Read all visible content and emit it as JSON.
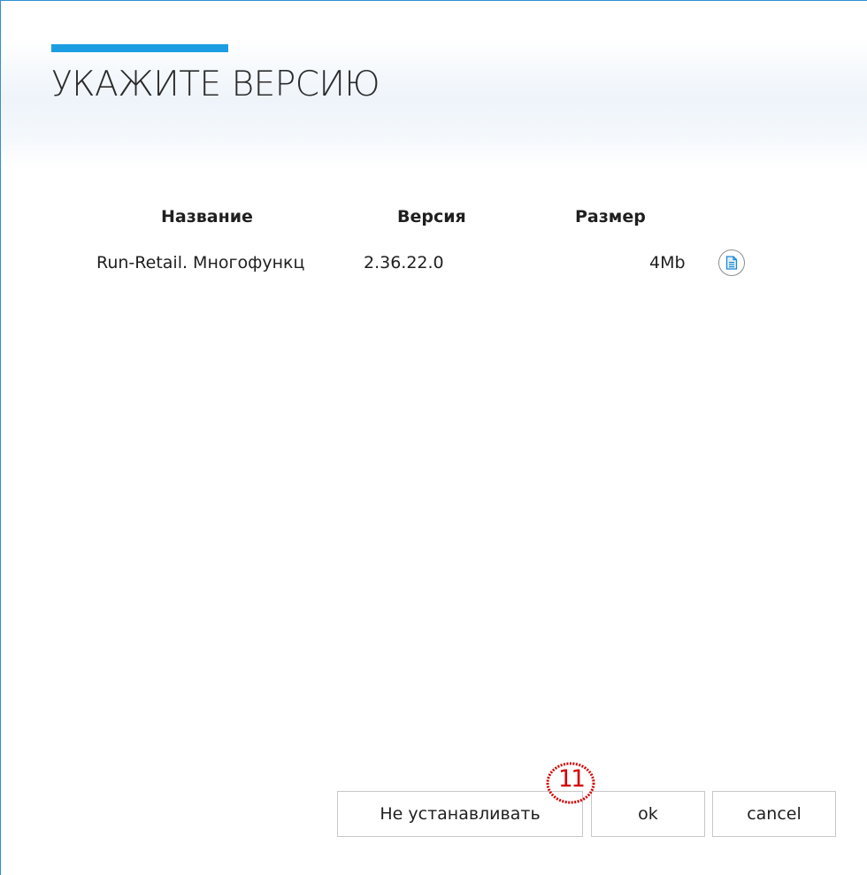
{
  "dialog": {
    "title": "УКАЖИТЕ ВЕРСИЮ",
    "accent_color": "#1c9de2",
    "border_color": "#2d8fd4"
  },
  "table": {
    "columns": [
      "Название",
      "Версия",
      "Размер"
    ],
    "rows": [
      {
        "name": "Run-Retail. Многофункц",
        "version": "2.36.22.0",
        "size": "4Mb",
        "action_icon": "document-icon"
      }
    ]
  },
  "buttons": {
    "skip_label": "Не устанавливать",
    "ok_label": "ok",
    "cancel_label": "cancel"
  },
  "annotation": {
    "marker_label": "11",
    "marker_color": "#d40000"
  }
}
